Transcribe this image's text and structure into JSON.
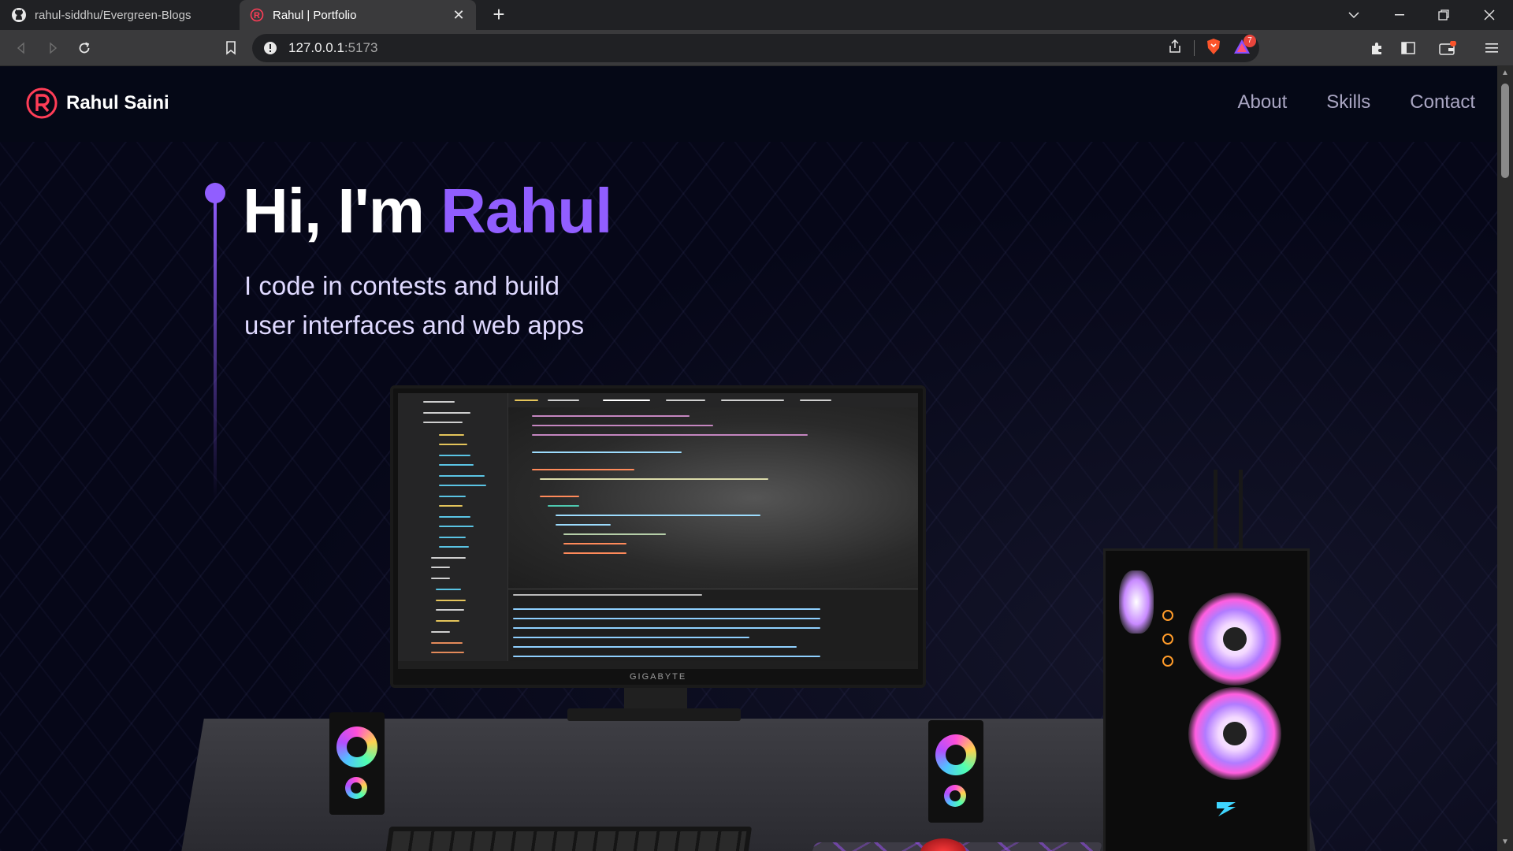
{
  "browser": {
    "tabs": [
      {
        "title": "rahul-siddhu/Evergreen-Blogs",
        "icon": "github-icon",
        "active": false
      },
      {
        "title": "Rahul | Portfolio",
        "icon": "portfolio-favicon",
        "active": true
      }
    ],
    "address": {
      "host": "127.0.0.1",
      "port": ":5173"
    },
    "notification_count": "7"
  },
  "navbar": {
    "logo_letter": "R",
    "brand_name": "Rahul Saini",
    "links": [
      "About",
      "Skills",
      "Contact"
    ]
  },
  "hero": {
    "greeting": "Hi, I'm ",
    "name": "Rahul",
    "subtitle_line1": "I code in contests and build",
    "subtitle_line2": "user interfaces and web apps"
  },
  "scene": {
    "monitor_brand": "GIGABYTE"
  },
  "colors": {
    "accent": "#915eff",
    "background": "#050816",
    "nav_text": "#aaa6c3",
    "subtitle_text": "#dfd9ff"
  }
}
